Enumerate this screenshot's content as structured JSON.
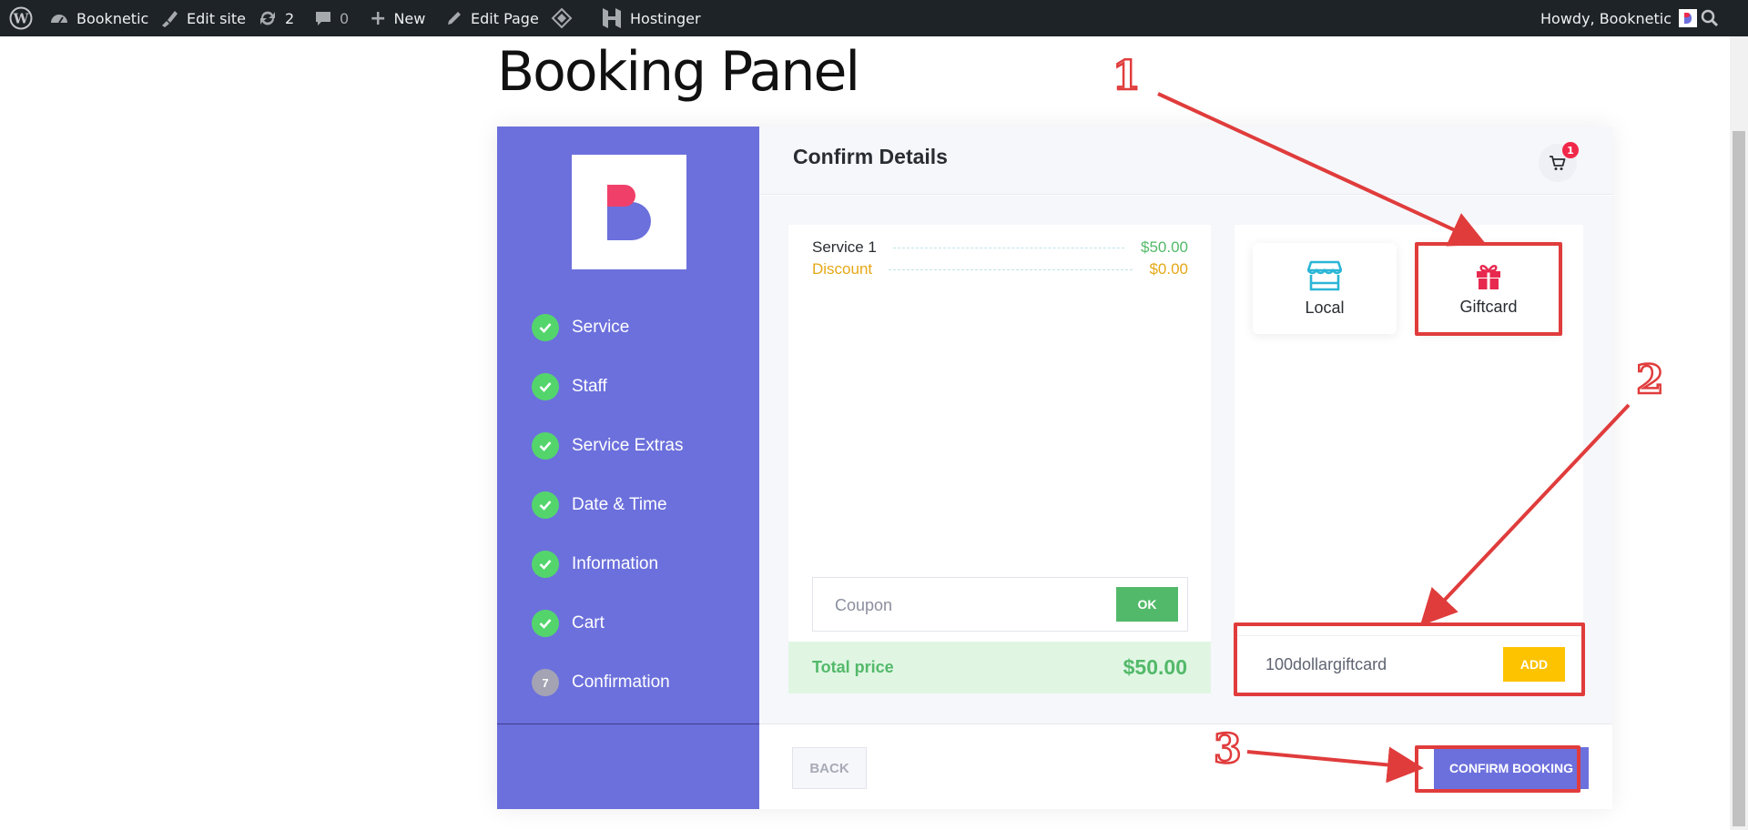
{
  "admin_bar": {
    "site_name": "Booknetic",
    "edit_site": "Edit site",
    "updates_count": "2",
    "comments_count": "0",
    "new_label": "New",
    "edit_page": "Edit Page",
    "hostinger": "Hostinger",
    "howdy": "Howdy, Booknetic"
  },
  "page": {
    "title": "Booking Panel"
  },
  "sidebar": {
    "steps": [
      {
        "label": "Service",
        "state": "done"
      },
      {
        "label": "Staff",
        "state": "done"
      },
      {
        "label": "Service Extras",
        "state": "done"
      },
      {
        "label": "Date & Time",
        "state": "done"
      },
      {
        "label": "Information",
        "state": "done"
      },
      {
        "label": "Cart",
        "state": "done"
      },
      {
        "label": "Confirmation",
        "state": "current",
        "number": "7"
      }
    ]
  },
  "header": {
    "title": "Confirm Details",
    "cart_count": "1"
  },
  "summary": {
    "rows": [
      {
        "label": "Service 1",
        "value": "$50.00"
      },
      {
        "label": "Discount",
        "value": "$0.00"
      }
    ],
    "coupon_placeholder": "Coupon",
    "coupon_button": "OK",
    "total_label": "Total price",
    "total_value": "$50.00"
  },
  "payment": {
    "methods": [
      {
        "label": "Local",
        "icon": "store-icon"
      },
      {
        "label": "Giftcard",
        "icon": "gift-icon"
      }
    ],
    "giftcard_value": "100dollargiftcard",
    "giftcard_button": "ADD"
  },
  "footer": {
    "back_label": "BACK",
    "confirm_label": "CONFIRM BOOKING"
  },
  "annotations": [
    "1",
    "2",
    "3"
  ],
  "colors": {
    "sidebar": "#6c70dc",
    "success": "#53b96a",
    "discount": "#e6a817",
    "giftcard_add": "#fdc300",
    "annotation": "#e03c3c",
    "cart_badge": "#f0284a"
  }
}
